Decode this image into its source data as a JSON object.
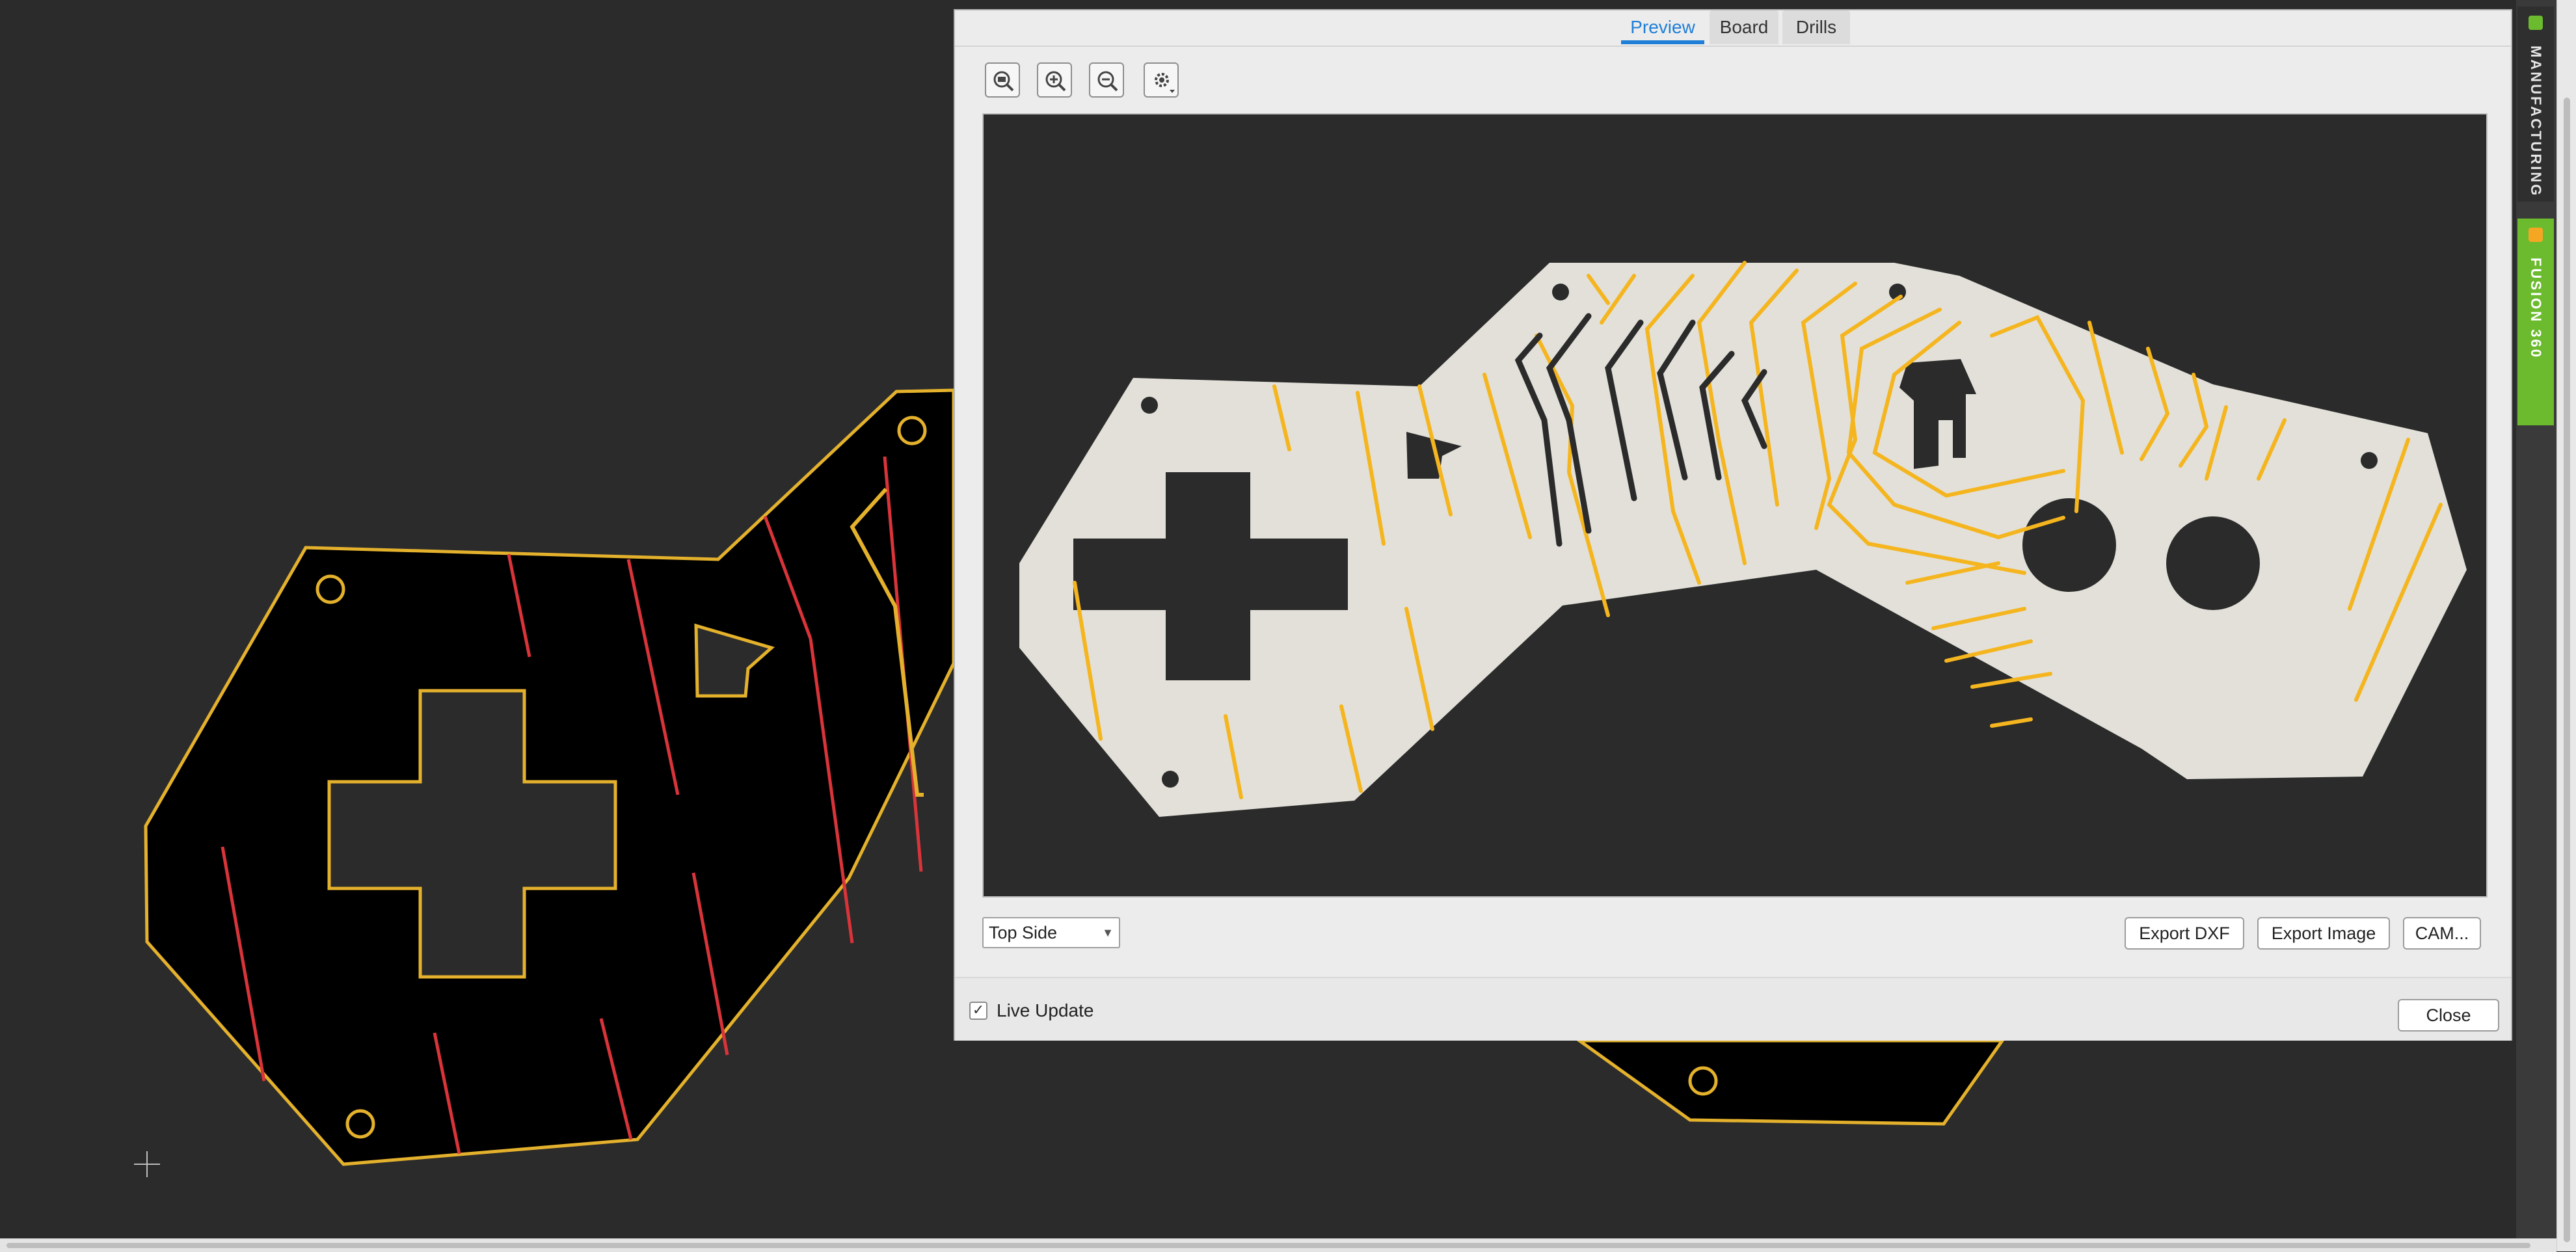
{
  "dialog": {
    "tabs": [
      {
        "label": "Preview",
        "active": true
      },
      {
        "label": "Board",
        "active": false
      },
      {
        "label": "Drills",
        "active": false
      }
    ],
    "toolbar": [
      "zoom-fit-icon",
      "zoom-in-icon",
      "zoom-out-icon",
      "settings-icon"
    ],
    "side_select": {
      "value": "Top Side"
    },
    "buttons": {
      "export_dxf": "Export DXF",
      "export_image": "Export Image",
      "cam": "CAM...",
      "close": "Close"
    },
    "live_update": {
      "label": "Live Update",
      "checked": true
    }
  },
  "side_panels": {
    "manufacturing": "MANUFACTURING",
    "fusion": "FUSION 360"
  },
  "colors": {
    "canvas_bg": "#2b2b2b",
    "board_outline": "#e4b12c",
    "trace_red": "#d8343a",
    "preview_board": "#e2e0d8",
    "preview_trace": "#f5b51e",
    "accent_blue": "#1f7ed6",
    "fusion_green": "#6cbb2f"
  }
}
